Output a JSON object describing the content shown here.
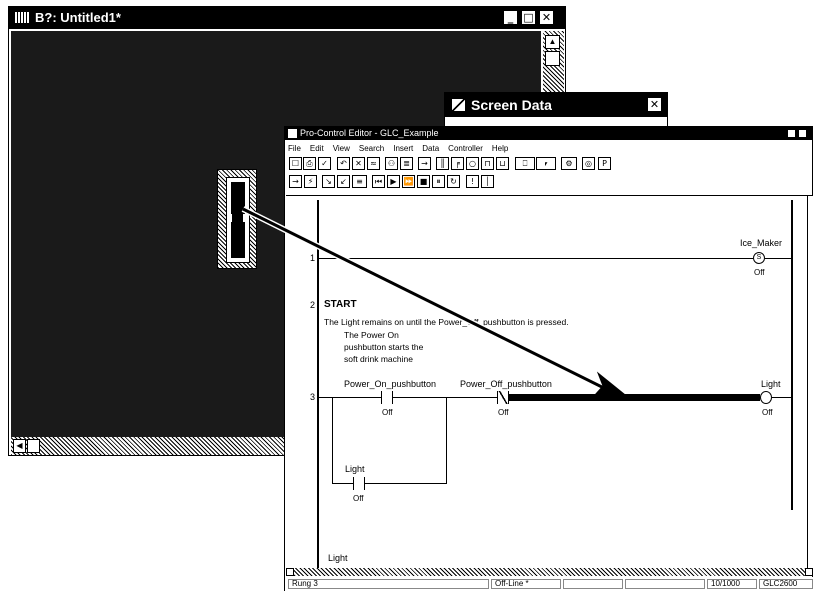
{
  "screen_window": {
    "title": "B?: Untitled1*"
  },
  "dialog": {
    "title": "Screen Data"
  },
  "editor": {
    "title": "Pro-Control Editor - GLC_Example",
    "menu": [
      "File",
      "Edit",
      "View",
      "Search",
      "Insert",
      "Data",
      "Controller",
      "Help"
    ],
    "toolbar1": [
      "☐",
      "⎙",
      "✓",
      "↶",
      "✕",
      "≈",
      "⚇",
      "≣",
      "→",
      "║",
      "╒",
      "○",
      "⊓",
      "⊔",
      "⎕",
      "⎖",
      "⚙",
      "◎",
      "P"
    ],
    "toolbar2": [
      "→",
      "⚡",
      "↘",
      "↙",
      "≡",
      "⏮",
      "▶",
      "⏩",
      "■",
      "⏸",
      "↻",
      "!",
      "│"
    ],
    "rungs": {
      "r1": {
        "number": "1",
        "coil_name": "Ice_Maker",
        "coil_symbol": "S",
        "coil_state": "Off"
      },
      "r2": {
        "number": "2",
        "label": "START",
        "comment": "The Light remains on until the Power_Off_pushbutton is pressed.",
        "comment2_line1": "The Power On",
        "comment2_line2": "pushbutton starts the",
        "comment2_line3": "soft drink machine"
      },
      "r3": {
        "number": "3",
        "contact1_name": "Power_On_pushbutton",
        "contact1_state": "Off",
        "contact2_name": "Power_Off_pushbutton",
        "contact2_state": "Off",
        "coil_name": "Light",
        "coil_state": "Off",
        "branch_name": "Light",
        "branch_state": "Off"
      },
      "r4": {
        "label": "Light"
      }
    },
    "status": {
      "rung": "Rung 3",
      "mode": "Off-Line *",
      "count": "10/1000",
      "device": "GLC2600"
    }
  },
  "colors": {
    "screen_bg": "#1a1a1a",
    "titlebar": "#000000",
    "arrow": "#000000"
  }
}
